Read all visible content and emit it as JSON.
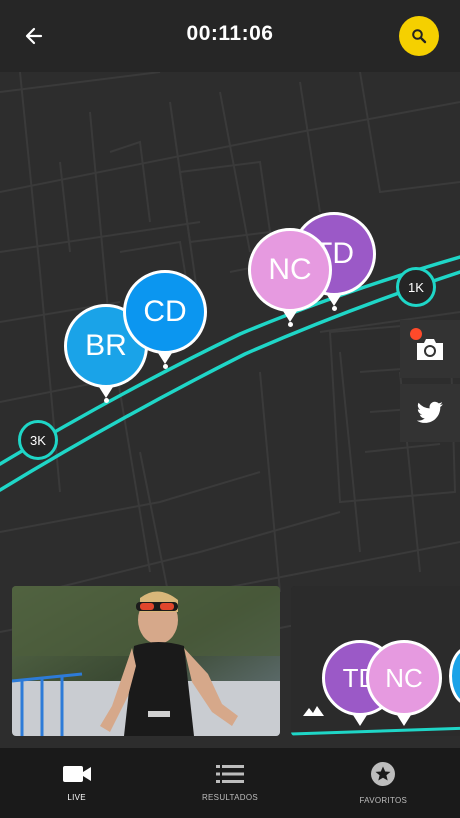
{
  "header": {
    "timer": "00:11:06",
    "back_icon": "arrow-left-icon",
    "search_icon": "search-icon",
    "accent_color": "#f5d000"
  },
  "map": {
    "route_color": "#1fd6c7",
    "km_markers": [
      {
        "label": "1K"
      },
      {
        "label": "3K"
      }
    ],
    "athletes": [
      {
        "label": "BR",
        "color": "#1aa3e8"
      },
      {
        "label": "CD",
        "color": "#0b96f0"
      },
      {
        "label": "TD",
        "color": "#9b59c7"
      },
      {
        "label": "NC",
        "color": "#e69ae0"
      }
    ],
    "side_buttons": [
      {
        "icon": "camera-icon",
        "has_notification": true
      },
      {
        "icon": "twitter-icon"
      }
    ]
  },
  "media_strip": {
    "photo_alt": "athlete-photo",
    "mini_map_pins": [
      {
        "label": "TD",
        "color": "#9b59c7"
      },
      {
        "label": "NC",
        "color": "#e69ae0"
      }
    ]
  },
  "bottom_nav": {
    "items": [
      {
        "label": "LIVE",
        "icon": "video-camera-icon",
        "active": true
      },
      {
        "label": "RESULTADOS",
        "icon": "list-icon",
        "active": false
      },
      {
        "label": "FAVORITOS",
        "icon": "star-icon",
        "active": false
      }
    ]
  }
}
